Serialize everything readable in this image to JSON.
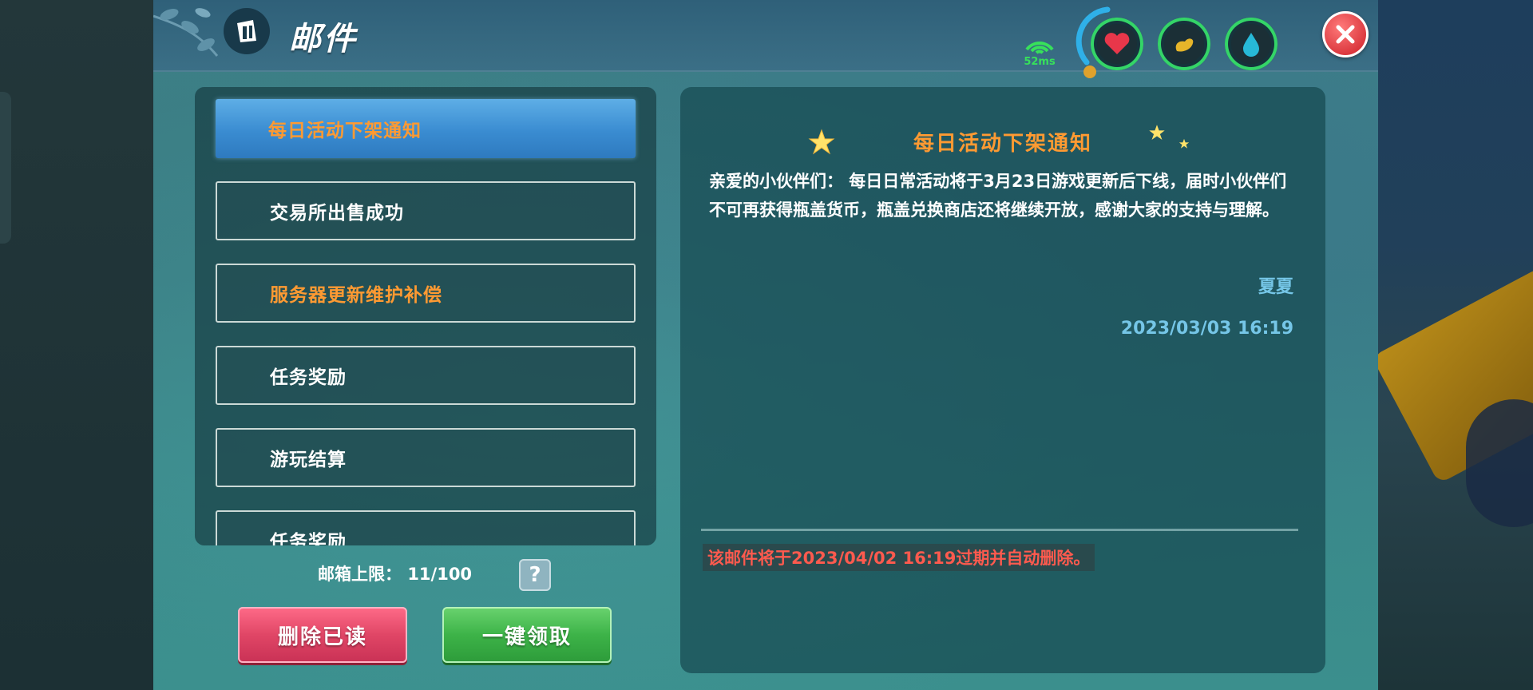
{
  "window": {
    "title": "邮件",
    "ping": "52ms"
  },
  "status_icons": [
    {
      "name": "heart-icon",
      "color": "#e8374a"
    },
    {
      "name": "stomach-icon",
      "color": "#e6b52a"
    },
    {
      "name": "water-drop-icon",
      "color": "#27b9d8"
    }
  ],
  "mail_list": {
    "items": [
      {
        "label": "每日活动下架通知",
        "highlight": true,
        "selected": true
      },
      {
        "label": "交易所出售成功",
        "highlight": false,
        "selected": false
      },
      {
        "label": "服务器更新维护补偿",
        "highlight": true,
        "selected": false
      },
      {
        "label": "任务奖励",
        "highlight": false,
        "selected": false
      },
      {
        "label": "游玩结算",
        "highlight": false,
        "selected": false
      },
      {
        "label": "任务奖励",
        "highlight": false,
        "selected": false
      }
    ],
    "capacity_label": "邮箱上限：",
    "capacity_value": "11/100",
    "help_label": "?"
  },
  "actions": {
    "delete_read": "删除已读",
    "claim_all": "一键领取"
  },
  "detail": {
    "title": "每日活动下架通知",
    "body": "亲爱的小伙伴们： 每日日常活动将于3月23日游戏更新后下线，届时小伙伴们不可再获得瓶盖货币，瓶盖兑换商店还将继续开放，感谢大家的支持与理解。",
    "sender": "夏夏",
    "date": "2023/03/03 16:19",
    "expiry": "该邮件将于2023/04/02 16:19过期并自动删除。"
  },
  "colors": {
    "accent_orange": "#ff9a32",
    "date_blue": "#75c6e7",
    "expiry_red": "#ff5a4e",
    "ring_green": "#34d568"
  }
}
